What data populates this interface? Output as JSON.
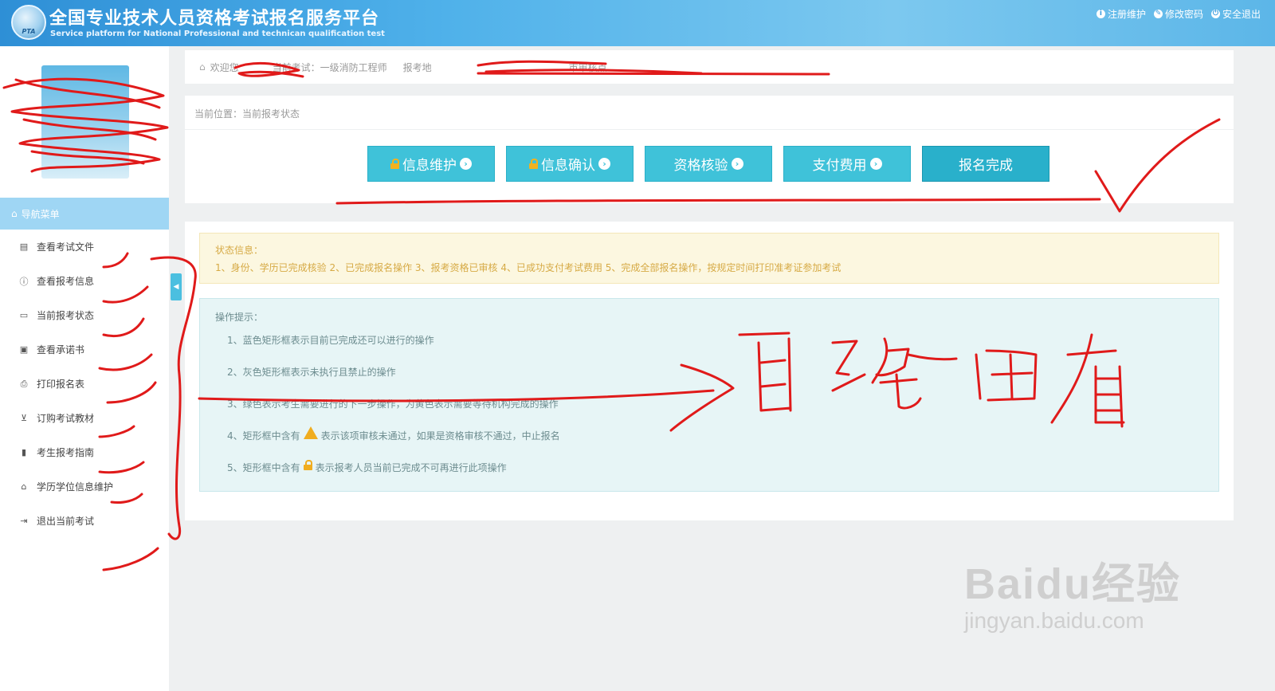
{
  "header": {
    "logo_text": "PTA",
    "title": "全国专业技术人员资格考试报名服务平台",
    "subtitle": "Service platform for National Professional and technican qualification test",
    "links": [
      {
        "label": "注册维护",
        "icon": "info-icon"
      },
      {
        "label": "修改密码",
        "icon": "edit-icon"
      },
      {
        "label": "安全退出",
        "icon": "power-icon"
      }
    ]
  },
  "info_bar": {
    "welcome": "欢迎您",
    "exam": "当前考试：一级消防工程师",
    "location": "报考地",
    "review_point": "市审核点"
  },
  "sidebar": {
    "nav_title": "导航菜单",
    "items": [
      {
        "label": "查看考试文件",
        "icon": "file-icon"
      },
      {
        "label": "查看报考信息",
        "icon": "info-icon"
      },
      {
        "label": "当前报考状态",
        "icon": "monitor-icon"
      },
      {
        "label": "查看承诺书",
        "icon": "id-card-icon"
      },
      {
        "label": "打印报名表",
        "icon": "print-icon"
      },
      {
        "label": "订购考试教材",
        "icon": "cart-icon"
      },
      {
        "label": "考生报考指南",
        "icon": "book-icon"
      },
      {
        "label": "学历学位信息维护",
        "icon": "graduation-cap-icon"
      },
      {
        "label": "退出当前考试",
        "icon": "sign-out-icon"
      }
    ]
  },
  "main": {
    "breadcrumb": "当前位置：当前报考状态",
    "steps": [
      {
        "label": "信息维护",
        "locked": true,
        "arrow": true
      },
      {
        "label": "信息确认",
        "locked": true,
        "arrow": true
      },
      {
        "label": "资格核验",
        "locked": false,
        "arrow": true
      },
      {
        "label": "支付费用",
        "locked": false,
        "arrow": true
      },
      {
        "label": "报名完成",
        "locked": false,
        "arrow": false
      }
    ],
    "status": {
      "title": "状态信息：",
      "text": "1、身份、学历已完成核验 2、已完成报名操作 3、报考资格已审核 4、已成功支付考试费用 5、完成全部报名操作，按规定时间打印准考证参加考试"
    },
    "hints": {
      "title": "操作提示：",
      "items": [
        {
          "prefix": "1、蓝色矩形框表示目前已完成还可以进行的操作",
          "suffix": ""
        },
        {
          "prefix": "2、灰色矩形框表示未执行且禁止的操作",
          "suffix": ""
        },
        {
          "prefix": "3、绿色表示考生需要进行的下一步操作，为黄色表示需要等待机构完成的操作",
          "suffix": ""
        },
        {
          "prefix": "4、矩形框中含有",
          "suffix": "表示该项审核未通过，如果是资格审核不通过，中止报名"
        },
        {
          "prefix": "5、矩形框中含有",
          "suffix": "表示报考人员当前已完成不可再进行此项操作"
        }
      ]
    }
  },
  "watermark": {
    "big": "Baidu经验",
    "small": "jingyan.baidu.com"
  },
  "colors": {
    "header": "#4fb1ea",
    "step": "#3fc2d9",
    "ink": "#e01a1a",
    "status_bg": "#fcf7e0",
    "hint_bg": "#e7f5f6"
  }
}
